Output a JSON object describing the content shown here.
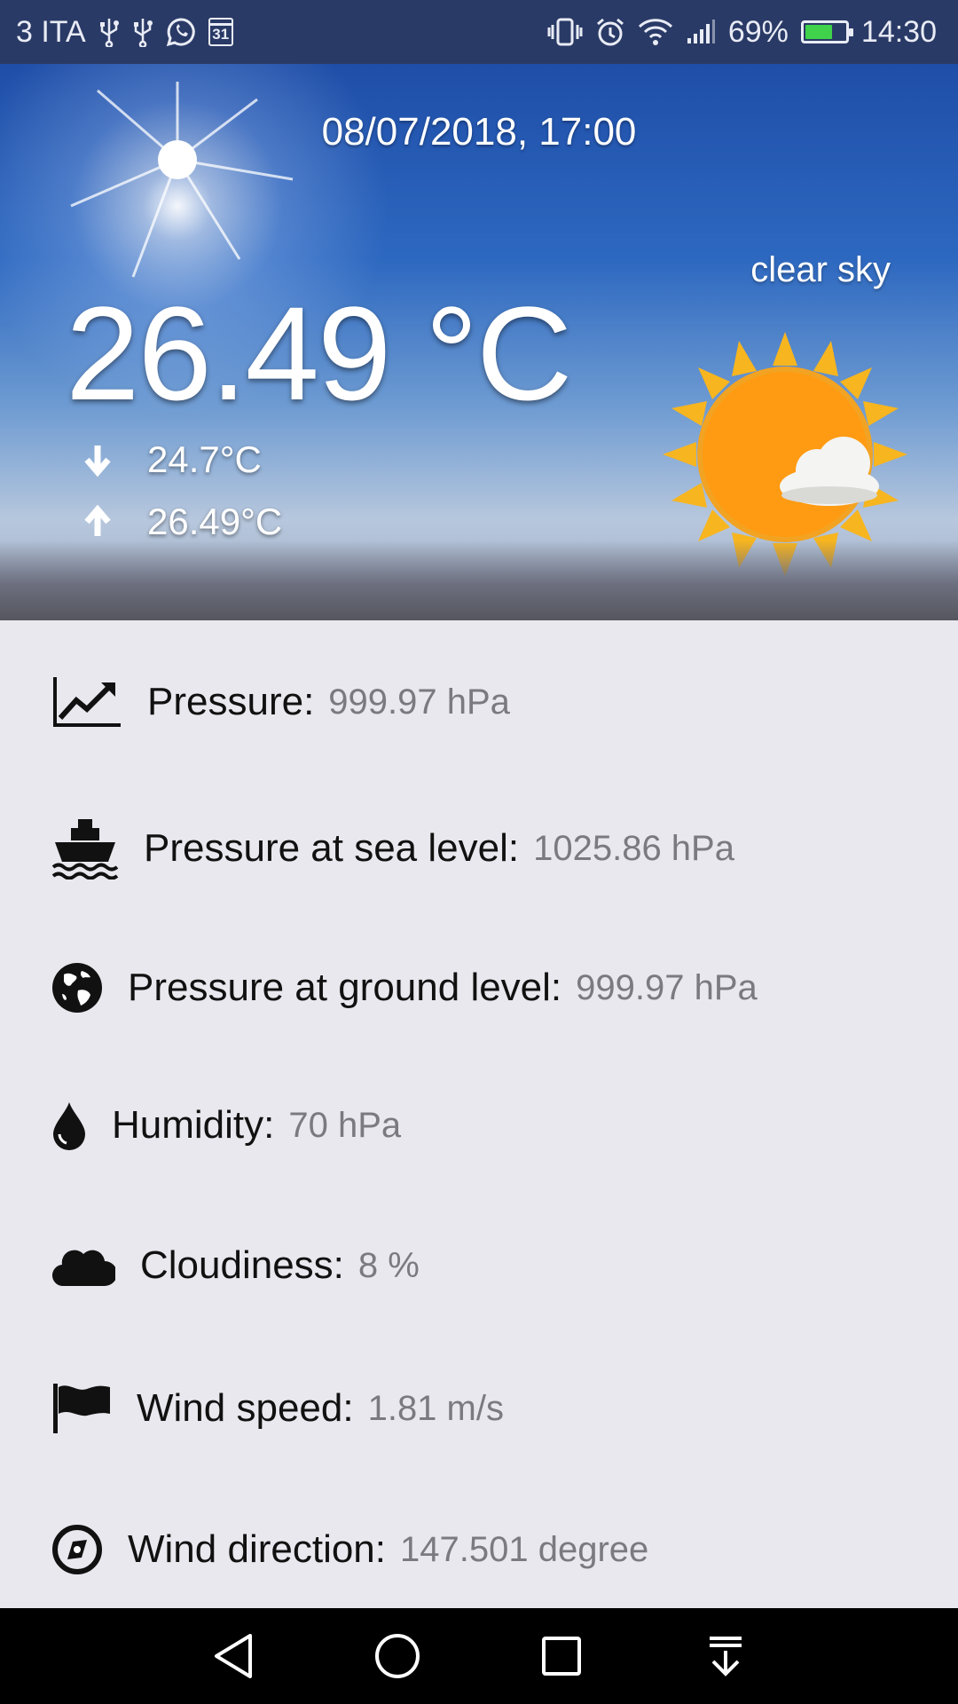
{
  "status_bar": {
    "carrier": "3 ITA",
    "calendar_day": "31",
    "battery_percent": "69%",
    "battery_level": 0.69,
    "time": "14:30",
    "icons": [
      "usb-icon",
      "usb-icon",
      "whatsapp-icon",
      "calendar-icon",
      "vibrate-icon",
      "alarm-icon",
      "wifi-icon",
      "signal-icon",
      "battery-charging-icon"
    ]
  },
  "weather": {
    "datetime": "08/07/2018, 17:00",
    "description": "clear sky",
    "temperature": "26.49 °C",
    "temp_min": "24.7°C",
    "temp_max": "26.49°C",
    "condition_icon": "sun-with-cloud-icon"
  },
  "details": [
    {
      "icon": "trending-up-chart-icon",
      "label": "Pressure:",
      "value": "999.97 hPa"
    },
    {
      "icon": "ship-icon",
      "label": "Pressure at sea level:",
      "value": "1025.86 hPa"
    },
    {
      "icon": "globe-icon",
      "label": "Pressure at ground level:",
      "value": "999.97 hPa"
    },
    {
      "icon": "water-drop-icon",
      "label": "Humidity:",
      "value": "70 hPa"
    },
    {
      "icon": "cloud-icon",
      "label": "Cloudiness:",
      "value": "8 %"
    },
    {
      "icon": "flag-icon",
      "label": "Wind speed:",
      "value": "1.81 m/s"
    },
    {
      "icon": "compass-icon",
      "label": "Wind direction:",
      "value": "147.501 degree"
    }
  ],
  "nav_bar": {
    "buttons": [
      "back-icon",
      "home-icon",
      "recents-icon",
      "notification-pull-icon"
    ]
  },
  "colors": {
    "status_bar_bg": "#2a3a66",
    "list_bg": "#e9e8ee",
    "value_text": "#7a7a80",
    "sun": "#ff9b12"
  }
}
